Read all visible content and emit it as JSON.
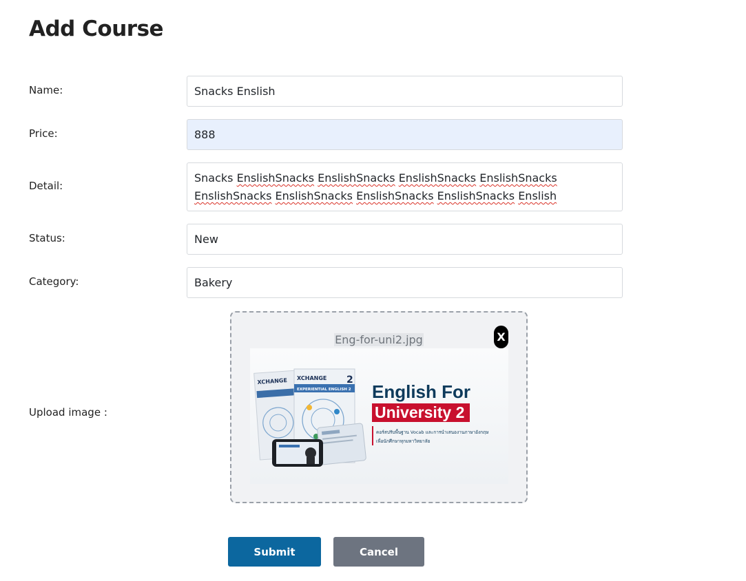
{
  "page": {
    "title": "Add Course"
  },
  "form": {
    "name_label": "Name:",
    "name_value": "Snacks Enslish",
    "price_label": "Price:",
    "price_value": "888",
    "detail_label": "Detail:",
    "detail_words": [
      "Snacks",
      "EnslishSnacks",
      "EnslishSnacks",
      "EnslishSnacks",
      "EnslishSnacks",
      "EnslishSnacks",
      "EnslishSnacks",
      "EnslishSnacks",
      "EnslishSnacks",
      "Enslish"
    ],
    "status_label": "Status:",
    "status_value": "New",
    "category_label": "Category:",
    "category_value": "Bakery",
    "upload_label": "Upload image :"
  },
  "upload": {
    "file_name": "Eng-for-uni2.jpg",
    "remove_label": "X",
    "preview": {
      "heading_line1": "English For",
      "heading_line2": "University 2",
      "book_label": "EXPERIENTIAL ENGLISH 2",
      "brand": "XCHANGE",
      "course_number": "2",
      "thai_line1": "คอร์สปรับพื้นฐาน Vocab และการนำเสนองานภาษาอังกฤษ",
      "thai_line2": "เพื่อนักศึกษาทุกมหาวิทยาลัย"
    }
  },
  "actions": {
    "submit_label": "Submit",
    "cancel_label": "Cancel"
  },
  "colors": {
    "submit": "#0c679f",
    "cancel": "#6d7480",
    "autofill": "#e8f0fd",
    "preview_title": "#0e3a5b",
    "preview_accent": "#c8102e"
  }
}
